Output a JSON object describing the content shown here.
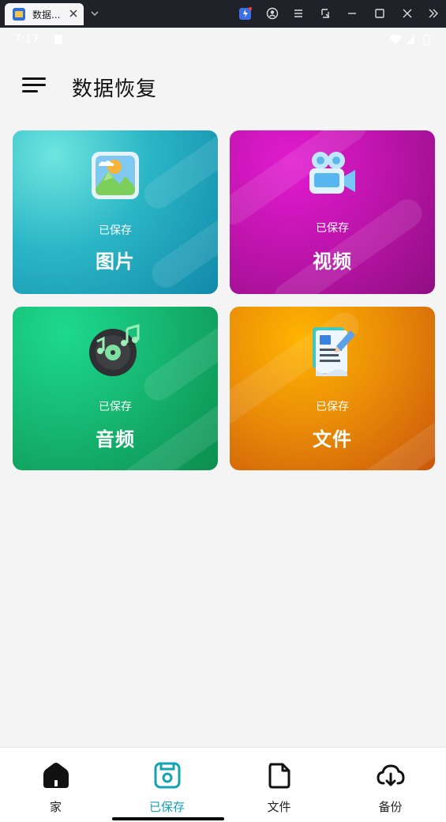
{
  "window": {
    "tab_title": "数据...",
    "icons": [
      "app-favicon",
      "close-icon",
      "chevron-down-icon",
      "extension-icon",
      "account-icon",
      "menu-icon",
      "screenshot-icon",
      "minimize-icon",
      "maximize-icon",
      "window-close-icon",
      "more-icon"
    ]
  },
  "status_bar": {
    "time": "7:17"
  },
  "header": {
    "title": "数据恢复"
  },
  "cards": [
    {
      "id": "photos",
      "subtitle": "已保存",
      "label": "图片",
      "icon": "image-icon"
    },
    {
      "id": "videos",
      "subtitle": "已保存",
      "label": "视频",
      "icon": "video-camera-icon"
    },
    {
      "id": "audio",
      "subtitle": "已保存",
      "label": "音频",
      "icon": "music-disc-icon"
    },
    {
      "id": "files",
      "subtitle": "已保存",
      "label": "文件",
      "icon": "document-icon"
    }
  ],
  "bottom_nav": {
    "active": "已保存",
    "accent_color": "#13a3b4",
    "items": [
      {
        "label": "家",
        "icon": "home-icon"
      },
      {
        "label": "已保存",
        "icon": "save-icon"
      },
      {
        "label": "文件",
        "icon": "file-icon"
      },
      {
        "label": "备份",
        "icon": "cloud-download-icon"
      }
    ]
  }
}
